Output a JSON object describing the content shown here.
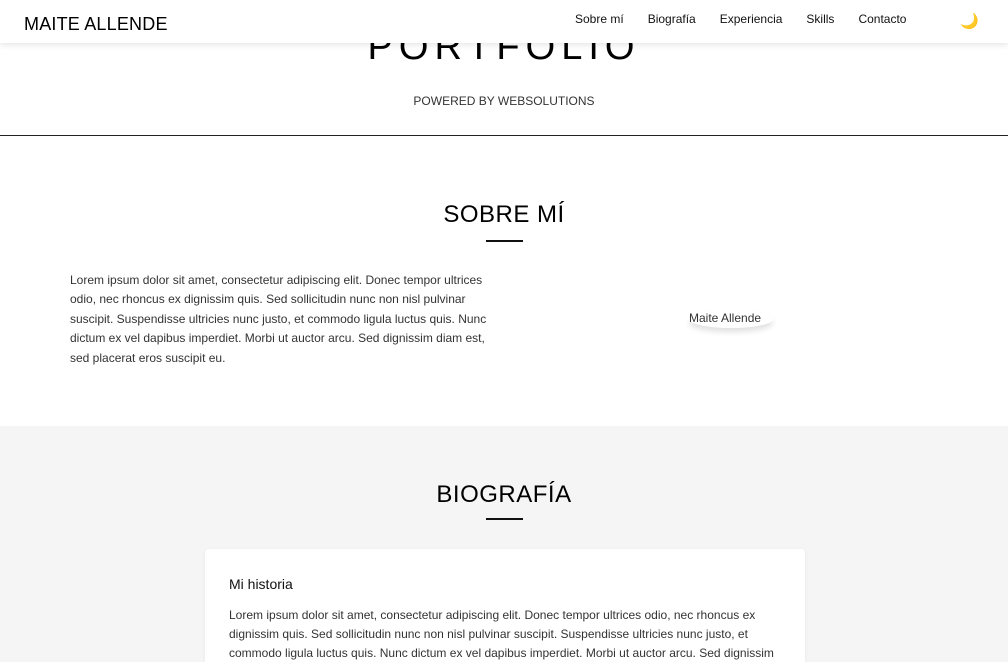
{
  "navbar": {
    "brand": "MAITE ALLENDE",
    "links": [
      "Sobre mí",
      "Biografía",
      "Experiencia",
      "Skills",
      "Contacto"
    ],
    "theme_icon": "moon-icon"
  },
  "hero": {
    "title": "PORTFOLIO",
    "subtitle": "POWERED BY WEBSOLUTIONS"
  },
  "about": {
    "title": "SOBRE MÍ",
    "text": "Lorem ipsum dolor sit amet, consectetur adipiscing elit. Donec tempor ultrices odio, nec rhoncus ex dignissim quis. Sed sollicitudin nunc non nisl pulvinar suscipit. Suspendisse ultricies nunc justo, et commodo ligula luctus quis. Nunc dictum ex vel dapibus imperdiet. Morbi ut auctor arcu. Sed dignissim diam est, sed placerat eros suscipit eu.",
    "photo_alt": "Maite Allende"
  },
  "bio": {
    "title": "BIOGRAFÍA",
    "card_title": "Mi historia",
    "card_text": "Lorem ipsum dolor sit amet, consectetur adipiscing elit. Donec tempor ultrices odio, nec rhoncus ex dignissim quis. Sed sollicitudin nunc non nisl pulvinar suscipit. Suspendisse ultricies nunc justo, et commodo ligula luctus quis. Nunc dictum ex vel dapibus imperdiet. Morbi ut auctor arcu. Sed dignissim"
  },
  "colors": {
    "accent_moon": "#f0b800",
    "bio_background": "#f5f5f5"
  }
}
